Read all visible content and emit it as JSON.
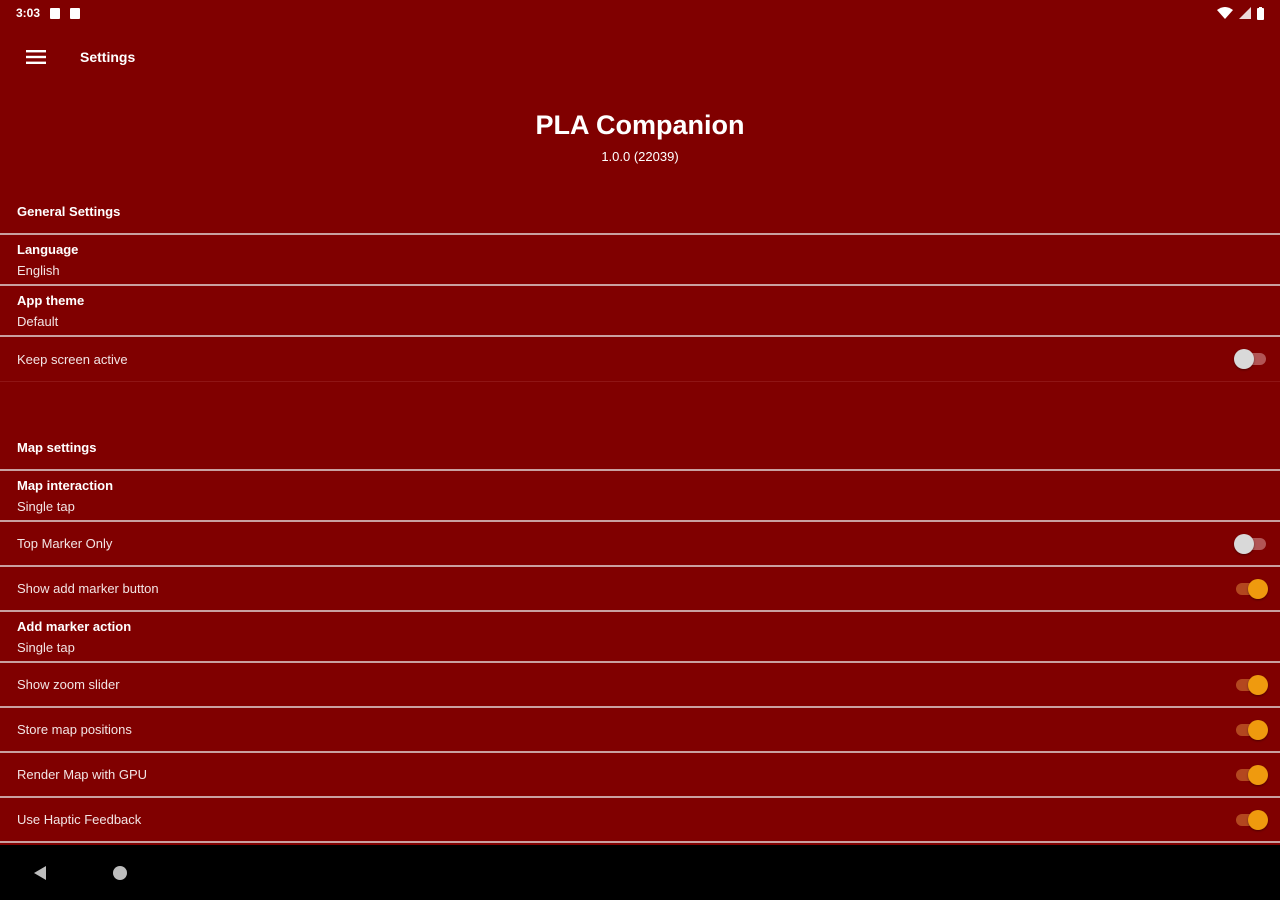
{
  "status_bar": {
    "time": "3:03"
  },
  "toolbar": {
    "title": "Settings",
    "menu_icon": "hamburger-menu-icon"
  },
  "header": {
    "app_name": "PLA Companion",
    "version": "1.0.0 (22039)"
  },
  "general_settings": {
    "header": "General Settings",
    "language": {
      "title": "Language",
      "value": "English"
    },
    "app_theme": {
      "title": "App theme",
      "value": "Default"
    },
    "keep_screen_active": {
      "label": "Keep screen active",
      "enabled": false
    }
  },
  "map_settings": {
    "header": "Map settings",
    "map_interaction": {
      "title": "Map interaction",
      "value": "Single tap"
    },
    "top_marker_only": {
      "label": "Top Marker Only",
      "enabled": false
    },
    "show_add_marker_button": {
      "label": "Show add marker button",
      "enabled": true
    },
    "add_marker_action": {
      "title": "Add marker action",
      "value": "Single tap"
    },
    "show_zoom_slider": {
      "label": "Show zoom slider",
      "enabled": true
    },
    "store_map_positions": {
      "label": "Store map positions",
      "enabled": true
    },
    "render_map_gpu": {
      "label": "Render Map with GPU",
      "enabled": true
    },
    "use_haptic_feedback": {
      "label": "Use Haptic Feedback",
      "enabled": true
    }
  },
  "colors": {
    "background": "#800000",
    "accent": "#ef9a0e",
    "nav_bar": "#000000"
  }
}
